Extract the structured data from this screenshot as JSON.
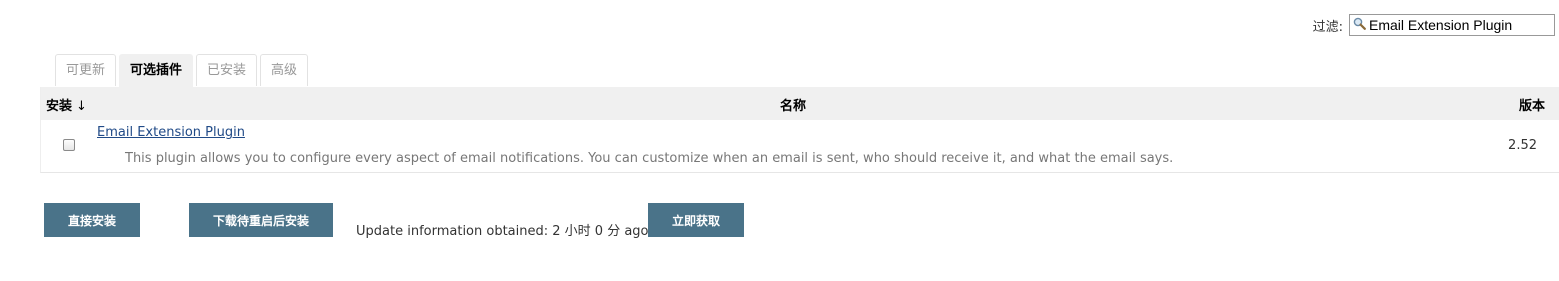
{
  "filter": {
    "label": "过滤:",
    "value": "Email Extension Plugin"
  },
  "tabs": [
    {
      "label": "可更新",
      "active": false
    },
    {
      "label": "可选插件",
      "active": true
    },
    {
      "label": "已安装",
      "active": false
    },
    {
      "label": "高级",
      "active": false
    }
  ],
  "table": {
    "headers": {
      "install": "安装",
      "sort_indicator": "↓",
      "name": "名称",
      "version": "版本"
    },
    "rows": [
      {
        "checked": false,
        "name": "Email Extension Plugin",
        "description": "This plugin allows you to configure every aspect of email notifications. You can customize when an email is sent, who should receive it, and what the email says.",
        "version": "2.52"
      }
    ]
  },
  "actions": {
    "install_now": "直接安装",
    "download_restart": "下载待重启后安装",
    "update_info": "Update information obtained: 2 小时 0 分 ago",
    "check_now": "立即获取"
  },
  "colors": {
    "button_bg": "#4a7389",
    "link": "#204a87",
    "header_bg": "#f0f0f0"
  },
  "icons": {
    "filter": "search-icon"
  }
}
